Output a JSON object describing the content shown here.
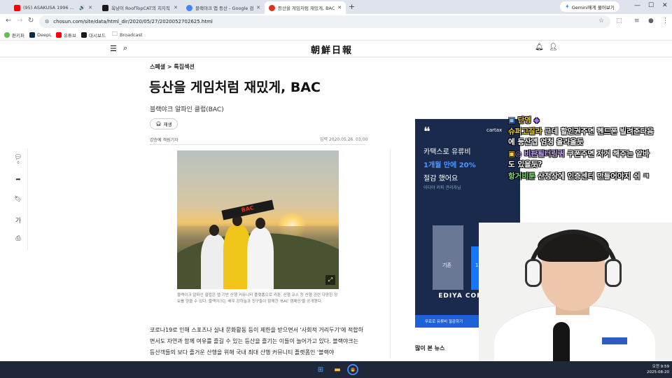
{
  "browser": {
    "tabs": [
      {
        "label": "(95) ASAKUSA 1996 ...",
        "color": "#ff0000"
      },
      {
        "label": "옥냥이 RoofTopCAT의 치지직",
        "color": "#1a1a1a"
      },
      {
        "label": "블랙야크 앱 등산 - Google 검",
        "color": "#4285f4"
      },
      {
        "label": "등산을 게임처럼 재밌게, BAC",
        "color": "#e0301e"
      }
    ],
    "gemini_label": "Gemini에게 물어보기",
    "url": "chosun.com/site/data/html_dir/2020/05/27/2020052702625.html",
    "bookmarks": [
      "편키퍼",
      "DeepL",
      "유튜브",
      "대시보드",
      "Broadcast"
    ]
  },
  "site": {
    "logo": "朝鮮日報"
  },
  "rail": {
    "comment_count": "0",
    "font_label": "가"
  },
  "article": {
    "breadcrumb": "스페셜 > 특집섹션",
    "title": "등산을 게임처럼 재밌게, BAC",
    "subtitle": "블랙야크 알파인 클럽(BAC)",
    "play_label": "재생",
    "byline": "강승예 객원기자",
    "date": "입력 2020.05.26. 03:00",
    "photo_banner": "BAC",
    "caption": "블랙야크 알파인 클럽은 앱 기반 산행 커뮤니티 플랫폼으로 카툰, 산행 코스 등 산행 관련 다양한 정보를 얻을 수 있다. 블랙야크는 배우 강하늘과 친구들이 함께한 'BAC 캠페인'을 공개했다.",
    "body": "코로나19로 인해 스포츠나 실내 문화활동 등이 제한을 받으면서 '사회적 거리두기'에 적합하면서도 자연과 함께 여유를 즐길 수 있는 등산을 즐기는 이들이 늘어가고 있다. 블랙야크는 등산객들의 보다 즐거운 산행을 위해 국내 최대 산행 커뮤니티 플랫폼인 '블랙야"
  },
  "ad": {
    "brand": "cartax",
    "line1": "카택스로 유류비",
    "line2": "1개월 만에 20%",
    "line3": "절감 했어요",
    "small": "이디야 커피 관리자님",
    "bar_before": "기존",
    "bar_after": "1개월 뒤",
    "logo": "EDIYA COFFEE",
    "footer": "무료로 유류비 절감하기"
  },
  "popular_label": "많이 본 뉴스",
  "chat": [
    {
      "name": "단영",
      "msg": "",
      "color": "#f3d233"
    },
    {
      "name": "슈퍼고질라",
      "msg": " 근데 할인권주면 헨드폰 빌려준다음",
      "color": "#f3d233"
    },
    {
      "name": "",
      "msg": "에 등산앱 엄청 올라올듯",
      "color": ""
    },
    {
      "name": "비판필터링퀴",
      "msg": " 쿠폰주면 저거 해주는 알바",
      "color": "#c9a6ff"
    },
    {
      "name": "",
      "msg": "도 있을듯?",
      "color": ""
    },
    {
      "name": "항거비툰",
      "msg": " 산정상에 인증센터 만들어야지 쉬 ㅋ",
      "color": "#7ee06f"
    }
  ],
  "taskbar": {
    "time": "오전 9:59",
    "date": "2025-08-20"
  }
}
